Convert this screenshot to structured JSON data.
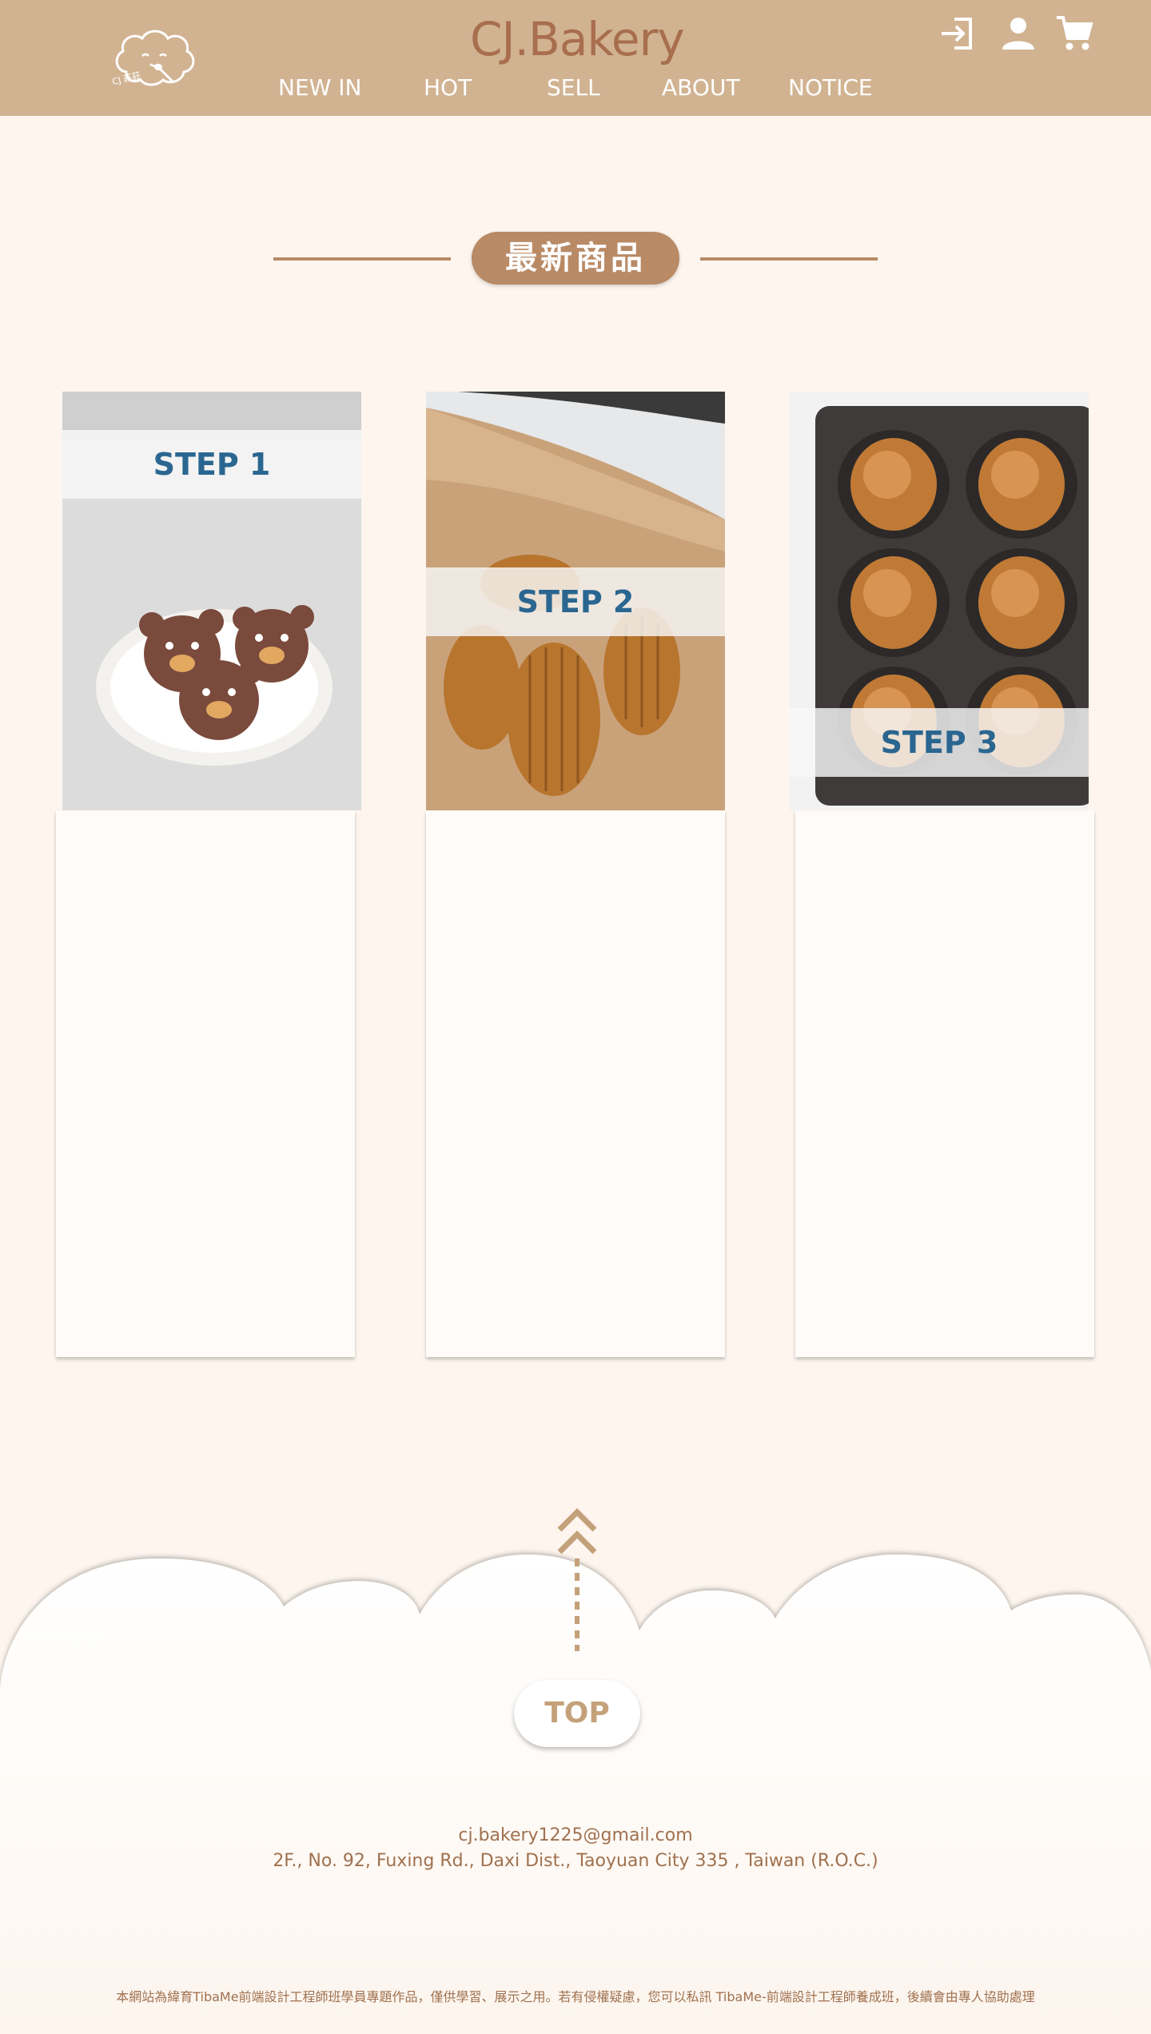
{
  "header": {
    "brand": "CJ.Bakery",
    "logo_caption": "CJ 莊莊",
    "nav": [
      "NEW IN",
      "HOT",
      "SELL",
      "ABOUT",
      "NOTICE"
    ],
    "icons": [
      "login-icon",
      "user-icon",
      "cart-icon"
    ]
  },
  "section": {
    "title": "最新商品"
  },
  "cards": [
    {
      "step": "STEP 1",
      "photo": "bear-cookies-on-plate"
    },
    {
      "step": "STEP 2",
      "photo": "madeleines-on-parchment"
    },
    {
      "step": "STEP 3",
      "photo": "madeleines-in-baking-tray"
    }
  ],
  "footer": {
    "top_label": "TOP",
    "email": "cj.bakery1225@gmail.com",
    "address": "2F., No. 92, Fuxing Rd., Daxi Dist., Taoyuan City 335 , Taiwan (R.O.C.)",
    "disclaimer": "本網站為緯育TibaMe前端設計工程師班學員專題作品，僅供學習、展示之用。若有侵權疑慮，您可以私訊 TibaMe-前端設計工程師養成班，後續會由專人協助處理"
  },
  "colors": {
    "header_bg": "#d1b392",
    "page_bg": "#fdf5ee",
    "accent": "#b88a66",
    "step_text": "#2a6690",
    "brand_text": "#a86e4e"
  }
}
